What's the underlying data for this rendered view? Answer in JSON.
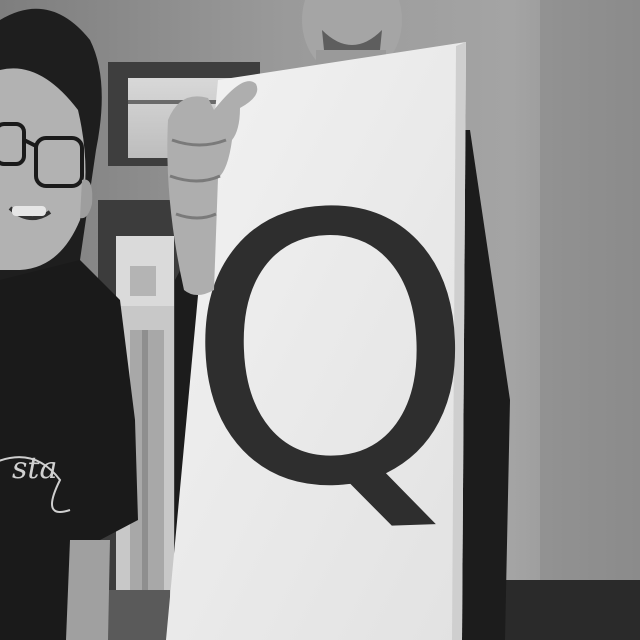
{
  "scene": {
    "description_type": "photo",
    "palette": {
      "wall": "#8f8f8f",
      "wall_light": "#a6a6a6",
      "paper": "#ececec",
      "letter": "#2e2e2e",
      "shirt": "#1a1a1a",
      "skin": "#b0b0b0",
      "skin_dark": "#8c8c8c",
      "frame": "#4a4a4a"
    }
  },
  "sign": {
    "letter": "Q"
  },
  "shirt_print": {
    "text": "sta"
  }
}
